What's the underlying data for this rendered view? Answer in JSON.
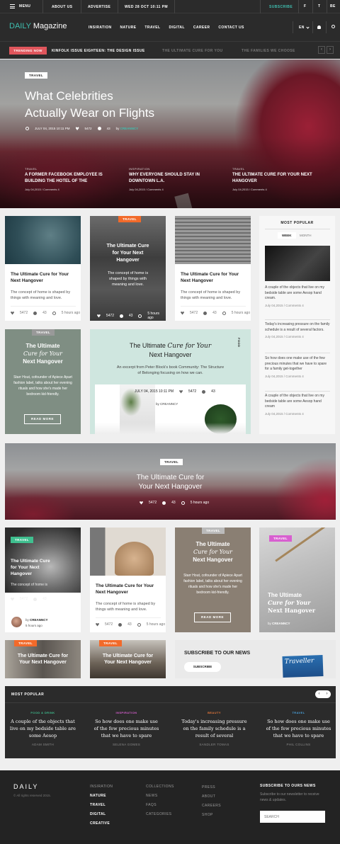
{
  "topbar": {
    "menu": "MENU",
    "about": "ABOUT US",
    "advertise": "ADVERTISE",
    "date": "WED 28 OCT 10:11 PM",
    "subscribe": "SUBSCRIBE",
    "social": [
      "f",
      "t",
      "Be"
    ]
  },
  "header": {
    "logo_a": "DAILY",
    "logo_b": "Magazine",
    "nav": [
      "INSIRATION",
      "NATURE",
      "TRAVEL",
      "DIGITAL",
      "CAREER",
      "CONTACT US"
    ],
    "lang": "EN"
  },
  "ticker": {
    "label": "TRENDING NOW",
    "items": [
      "KINFOLK ISSUE EIGHTEEN: THE DESIGN ISSUE",
      "THE ULTIMATE CURE FOR YOU",
      "THE FAMILIES WE CHOOSE"
    ]
  },
  "hero": {
    "tag": "TRAVEL",
    "title_l1": "What Celebrities",
    "title_l2": "Actually Wear on Flights",
    "date": "JULY 04, 2015 10:11 PM",
    "likes": "5472",
    "comments": "43",
    "by": "by",
    "author": "CREANNCY",
    "subs": [
      {
        "cat": "TRAVEL",
        "title": "A FORMER FACEBOOK EMPLOYEE IS BUILDING THE HOTEL OF THE",
        "meta": "July 04,2015 / Comments 4"
      },
      {
        "cat": "INSPIRATION",
        "title": "WHY EVERYONE SHOULD STAY IN DOWNTOWN L.A.",
        "meta": "July 04,2015 / Comments 4"
      },
      {
        "cat": "TRAVEL",
        "title": "THE ULTIMATE CURE FOR YOUR NEXT HANGOVER",
        "meta": "July 04,2015 / Comments 4"
      }
    ]
  },
  "card_title": "The Ultimate Cure for Your Next Hangover",
  "card_title_l1": "The Ultimate Cure",
  "card_title_l2": "for Your Next",
  "card_title_l3": "Hangover",
  "card_desc": "The concept of home is shaped by things with meaning and love.",
  "card_desc_l1": "The concept of home is",
  "card_desc_l2": "shaped by things with",
  "card_desc_l3": "meaning and love.",
  "card_likes": "5472",
  "card_comments": "43",
  "card_time": "5 hours ago",
  "tag_travel": "TRAVEL",
  "tag_food": "FOOD",
  "popular": {
    "title": "MOST POPULAR",
    "tabs": [
      "WEEK",
      "MONTH"
    ],
    "items": [
      {
        "text": "A couple of the objects that live on my bedside table are some Aesop hand cream.",
        "meta": "July 04,2015 / Comments 4"
      },
      {
        "text": "Today's increasing pressure on the family schedule is a result of several factors.",
        "meta": "July 04,2015 / Comments 4"
      },
      {
        "text": "So how does one make use of the few precious minutes that we have to spare for a family get-together",
        "meta": "July 04,2015 / Comments 4"
      },
      {
        "text": "A couple of the objects that live on my bedside table are some Aesop hand cream",
        "meta": "July 04,2015 / Comments 4"
      }
    ]
  },
  "quote": {
    "l1": "The Ultimate",
    "l2": "Cure for Your",
    "l3": "Next Hangover",
    "desc": "Starr Hout, cofounder of Apiece Apart fashion label, talks about her evening rituals and how she's made her bedroom kid-friendly.",
    "btn": "READ MORE"
  },
  "feature": {
    "title_a": "The Ultimate",
    "title_b": "Cure for Your",
    "title_c": "Next Hangover",
    "desc": "An excerpt from Peter Block's book Community: The Structure of Belonging focusing on how we can.",
    "date": "JULY 04, 2015 10:11 PM",
    "by": "by CREANNCY"
  },
  "banner": {
    "tag": "TRAVEL",
    "l1": "The Ultimate Cure for",
    "l2": "Your Next Hangover"
  },
  "row3": {
    "author": "CREANNCY",
    "by": "by",
    "time": "5 hours ago"
  },
  "subscribe": {
    "title": "SUBSCRIBE TO OUR NEWS",
    "btn": "SUBSCRIBE",
    "mag": "Traveller"
  },
  "popular2": {
    "title": "MOST POPULAR",
    "items": [
      {
        "cat": "FOOD & DRINK",
        "color": "#3fbf8f",
        "text": "A couple of the objects that live on my bedside table are some Aesop",
        "author": "ADAM SMITH"
      },
      {
        "cat": "INSPIRATION",
        "color": "#d85fd0",
        "text": "So how does one make use of the few precious minutes that we have to spare",
        "author": "SELENA GOMES"
      },
      {
        "cat": "BEAUTY",
        "color": "#f07b3a",
        "text": "Today's increasing pressure on the family schedule is a result of several",
        "author": "SANDLER TOMAS"
      },
      {
        "cat": "TRAVEL",
        "color": "#4aa3df",
        "text": "So how does one make use of the few precious minutes that we have to spare",
        "author": "PHIL COLLINS"
      }
    ]
  },
  "footer": {
    "logo": "DAILY",
    "copy": "© All rights reserved 2015.",
    "col1": [
      "INSIRATION",
      "NATURE",
      "TRAVEL",
      "DIGITAL",
      "CREATIVE"
    ],
    "col2": [
      "COLLECTIONS",
      "NEWS",
      "FAQS",
      "CATEGORIES"
    ],
    "col3": [
      "PRESS",
      "ABOUT",
      "CAREERS",
      "SHOP"
    ],
    "sub_title": "SUBSCRIBE TO OURS NEWS",
    "sub_desc": "Subscribe to our newsletter to receive news & updates.",
    "search": "SEARCH"
  },
  "colors": {
    "accent": "#3fbfb0",
    "tag_orange": "#f26a2a",
    "ticker_red": "#e0565c",
    "sage": "#7f8e83",
    "mint": "#cfe6df",
    "taupe": "#8a7f73",
    "green_tag": "#3fbf8f",
    "pink_tag": "#d85fd0"
  }
}
